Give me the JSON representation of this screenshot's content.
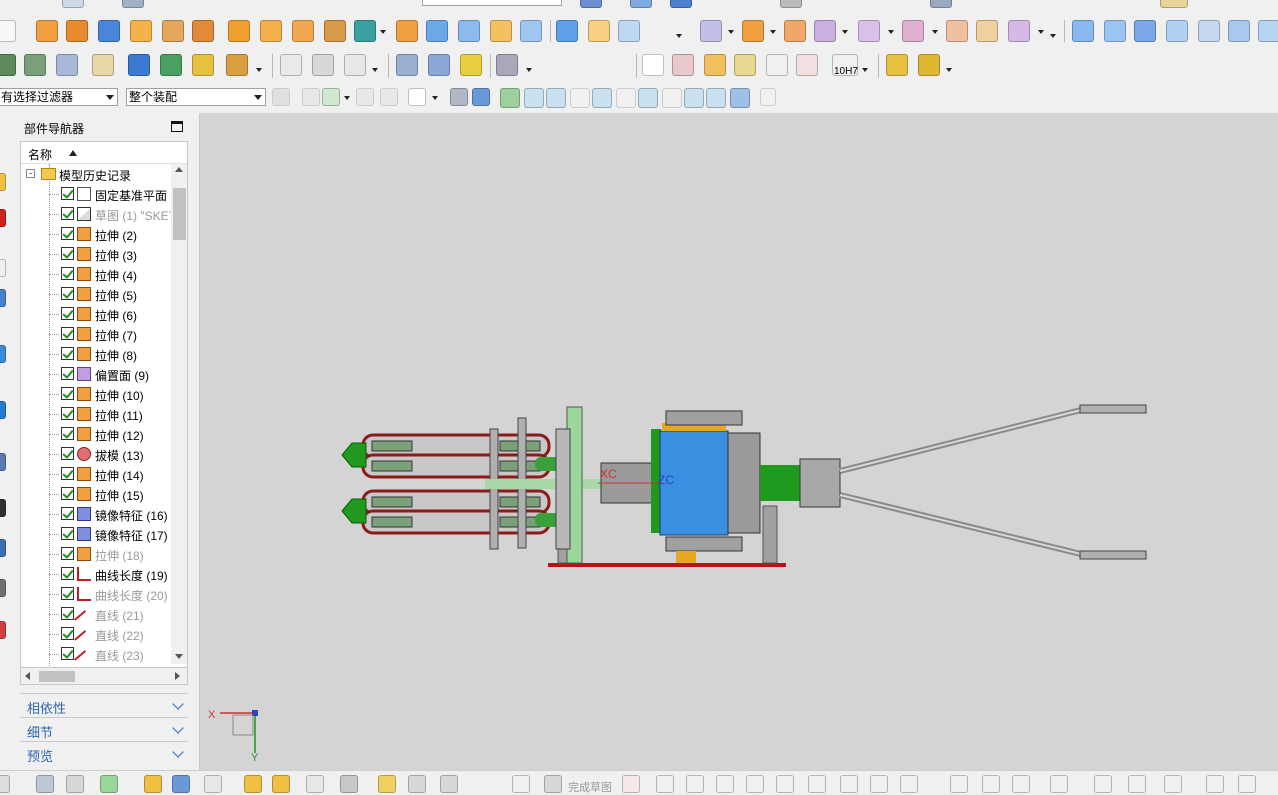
{
  "filter_combo": {
    "value": "有选择过滤器"
  },
  "assembly_combo": {
    "value": "整个装配"
  },
  "navigator": {
    "title": "部件导航器",
    "column_name": "名称",
    "root": "模型历史记录",
    "items": [
      {
        "label": "固定基准平面",
        "icon": "datum-plane-icon",
        "dim": false
      },
      {
        "label": "草图 (1) \"SKET",
        "icon": "sketch-icon",
        "dim": true
      },
      {
        "label": "拉伸 (2)",
        "icon": "extrude-icon",
        "dim": false
      },
      {
        "label": "拉伸 (3)",
        "icon": "extrude-icon",
        "dim": false
      },
      {
        "label": "拉伸 (4)",
        "icon": "extrude-icon",
        "dim": false
      },
      {
        "label": "拉伸 (5)",
        "icon": "extrude-icon",
        "dim": false
      },
      {
        "label": "拉伸 (6)",
        "icon": "extrude-icon",
        "dim": false
      },
      {
        "label": "拉伸 (7)",
        "icon": "extrude-icon",
        "dim": false
      },
      {
        "label": "拉伸 (8)",
        "icon": "extrude-icon",
        "dim": false
      },
      {
        "label": "偏置面 (9)",
        "icon": "offset-face-icon",
        "dim": false
      },
      {
        "label": "拉伸 (10)",
        "icon": "extrude-icon",
        "dim": false
      },
      {
        "label": "拉伸 (11)",
        "icon": "extrude-icon",
        "dim": false
      },
      {
        "label": "拉伸 (12)",
        "icon": "extrude-icon",
        "dim": false
      },
      {
        "label": "拔模 (13)",
        "icon": "draft-icon",
        "dim": false
      },
      {
        "label": "拉伸 (14)",
        "icon": "extrude-icon",
        "dim": false
      },
      {
        "label": "拉伸 (15)",
        "icon": "extrude-icon",
        "dim": false
      },
      {
        "label": "镜像特征 (16)",
        "icon": "mirror-icon",
        "dim": false
      },
      {
        "label": "镜像特征 (17)",
        "icon": "mirror-icon",
        "dim": false
      },
      {
        "label": "拉伸 (18)",
        "icon": "extrude-icon",
        "dim": true
      },
      {
        "label": "曲线长度 (19)",
        "icon": "curve-length-icon",
        "dim": false
      },
      {
        "label": "曲线长度 (20)",
        "icon": "curve-length-icon",
        "dim": true
      },
      {
        "label": "直线 (21)",
        "icon": "line-icon",
        "dim": true
      },
      {
        "label": "直线 (22)",
        "icon": "line-icon",
        "dim": true
      },
      {
        "label": "直线 (23)",
        "icon": "line-icon",
        "dim": true
      }
    ]
  },
  "panels": [
    {
      "label": "相依性"
    },
    {
      "label": "细节"
    },
    {
      "label": "预览"
    }
  ],
  "viewport": {
    "axis_xc": "XC",
    "axis_zc": "ZC",
    "triad_x": "X",
    "triad_y": "Y"
  },
  "toolbar_right_label": "10H7",
  "bottom_label": "完成草图",
  "colors": {
    "accent_blue": "#2a64b0",
    "model_red": "#b01818",
    "model_blue": "#3a8fe0",
    "model_green": "#1f9a1f"
  }
}
